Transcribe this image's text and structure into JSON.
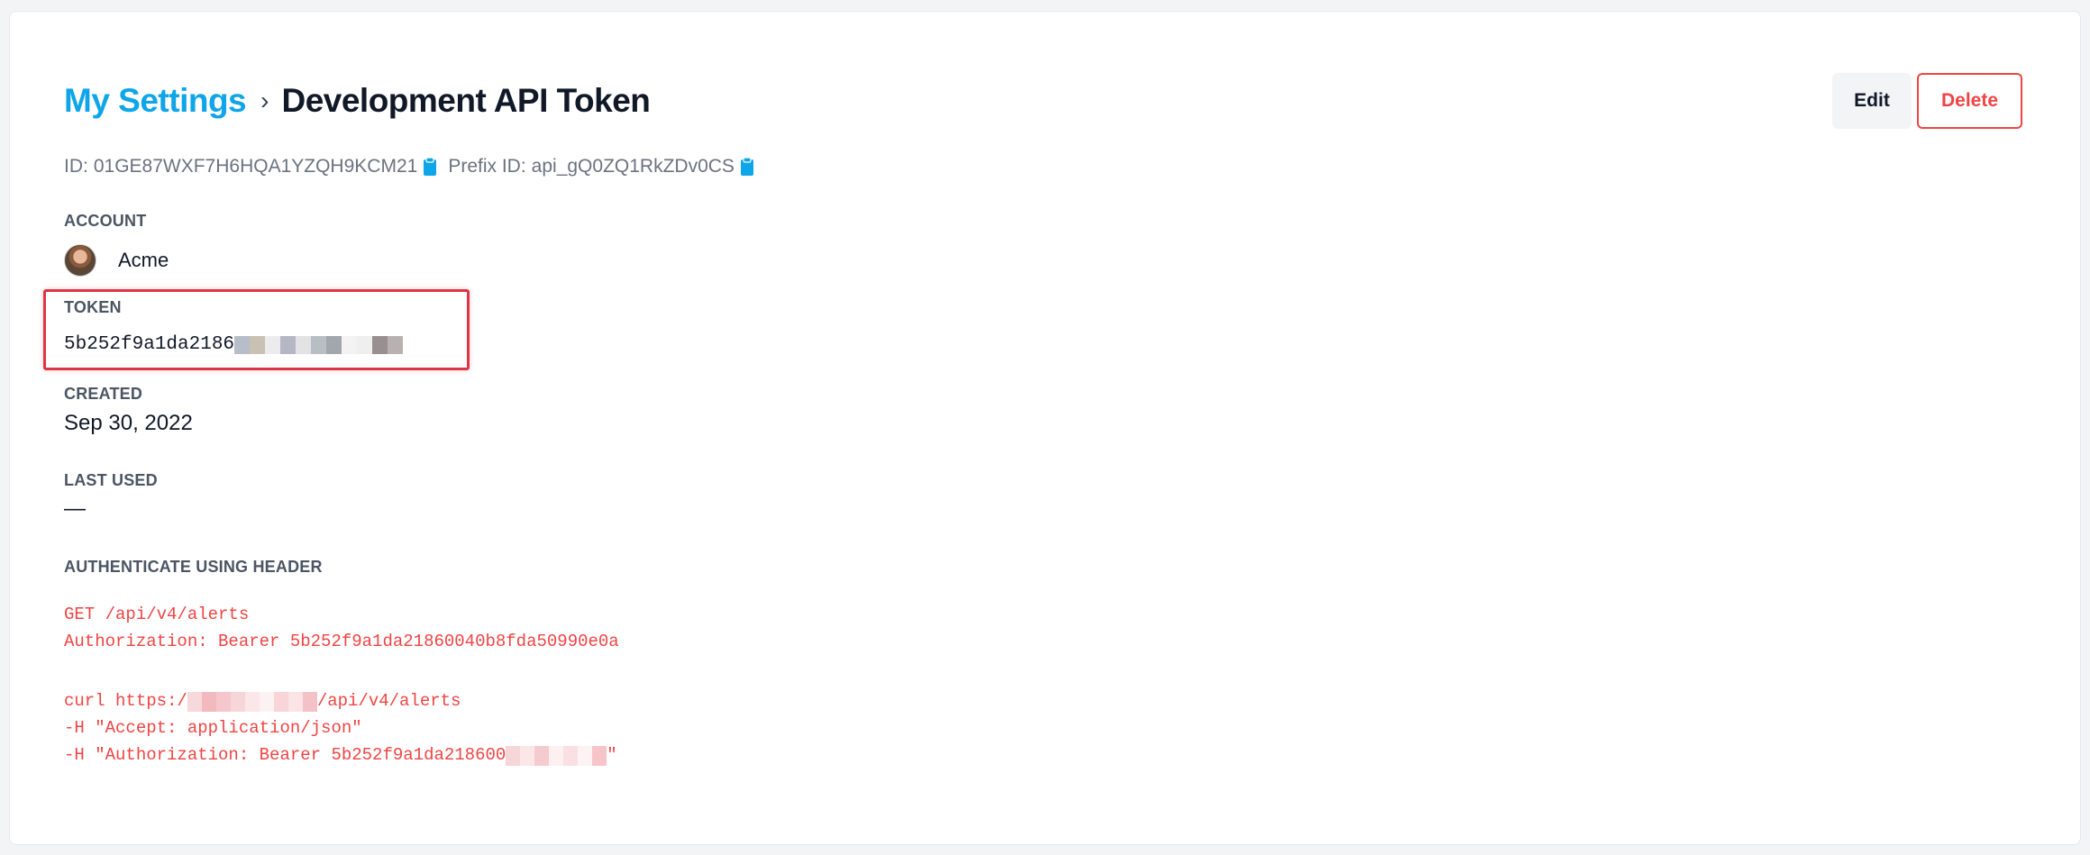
{
  "breadcrumb": {
    "parent": "My Settings",
    "separator": "›",
    "current": "Development API Token"
  },
  "actions": {
    "edit_label": "Edit",
    "delete_label": "Delete"
  },
  "ids": {
    "id_label": "ID:",
    "id_value": "01GE87WXF7H6HQA1YZQH9KCM21",
    "prefix_label": "Prefix ID:",
    "prefix_value": "api_gQ0ZQ1RkZDv0CS"
  },
  "account": {
    "label": "ACCOUNT",
    "name": "Acme"
  },
  "token": {
    "label": "TOKEN",
    "visible_part": "5b252f9a1da2186"
  },
  "created": {
    "label": "CREATED",
    "value": "Sep 30, 2022"
  },
  "last_used": {
    "label": "LAST USED",
    "value": "—"
  },
  "auth_header": {
    "label": "AUTHENTICATE USING HEADER",
    "line1": "GET /api/v4/alerts",
    "line2": "Authorization: Bearer 5b252f9a1da21860040b8fda50990e0a",
    "curl_prefix": "curl https:/",
    "curl_suffix": "/api/v4/alerts",
    "line4": "-H \"Accept: application/json\"",
    "line5_prefix": "-H \"Authorization: Bearer 5b252f9a1da218600",
    "line5_suffix": "\""
  },
  "colors": {
    "accent": "#0ea5e9",
    "danger": "#ef4444",
    "highlight": "#dc3545"
  }
}
